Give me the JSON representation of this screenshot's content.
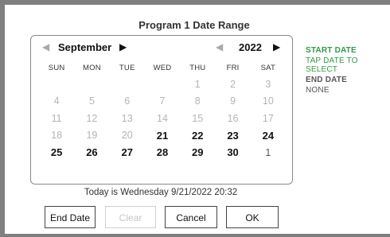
{
  "dialog": {
    "title": "Program 1 Date Range"
  },
  "calendar": {
    "month": "September",
    "year": "2022",
    "weekdays": [
      "SUN",
      "MON",
      "TUE",
      "WED",
      "THU",
      "FRI",
      "SAT"
    ],
    "weeks": [
      [
        {
          "d": ""
        },
        {
          "d": ""
        },
        {
          "d": ""
        },
        {
          "d": ""
        },
        {
          "d": "1",
          "s": "past"
        },
        {
          "d": "2",
          "s": "past"
        },
        {
          "d": "3",
          "s": "past"
        }
      ],
      [
        {
          "d": "4",
          "s": "past"
        },
        {
          "d": "5",
          "s": "past"
        },
        {
          "d": "6",
          "s": "past"
        },
        {
          "d": "7",
          "s": "past"
        },
        {
          "d": "8",
          "s": "past"
        },
        {
          "d": "9",
          "s": "past"
        },
        {
          "d": "10",
          "s": "past"
        }
      ],
      [
        {
          "d": "11",
          "s": "past"
        },
        {
          "d": "12",
          "s": "past"
        },
        {
          "d": "13",
          "s": "past"
        },
        {
          "d": "14",
          "s": "past"
        },
        {
          "d": "15",
          "s": "past"
        },
        {
          "d": "16",
          "s": "past"
        },
        {
          "d": "17",
          "s": "past"
        }
      ],
      [
        {
          "d": "18",
          "s": "past"
        },
        {
          "d": "19",
          "s": "past"
        },
        {
          "d": "20",
          "s": "past"
        },
        {
          "d": "21",
          "s": "active"
        },
        {
          "d": "22",
          "s": "active"
        },
        {
          "d": "23",
          "s": "active"
        },
        {
          "d": "24",
          "s": "active"
        }
      ],
      [
        {
          "d": "25",
          "s": "active"
        },
        {
          "d": "26",
          "s": "active"
        },
        {
          "d": "27",
          "s": "active"
        },
        {
          "d": "28",
          "s": "active"
        },
        {
          "d": "29",
          "s": "active"
        },
        {
          "d": "30",
          "s": "active"
        },
        {
          "d": "1",
          "s": "next"
        }
      ]
    ]
  },
  "today_text": "Today is Wednesday  9/21/2022  20:32",
  "buttons": {
    "end_date": "End Date",
    "clear": "Clear",
    "cancel": "Cancel",
    "ok": "OK"
  },
  "side_panel": {
    "start_label": "START DATE",
    "start_value": "TAP DATE TO SELECT",
    "end_label": "END DATE",
    "end_value": "NONE"
  },
  "colors": {
    "accent_green": "#2f9a47",
    "frame_gray": "#7f7f7f"
  },
  "icons": {
    "prev": "triangle-left-icon",
    "next": "triangle-right-icon"
  }
}
